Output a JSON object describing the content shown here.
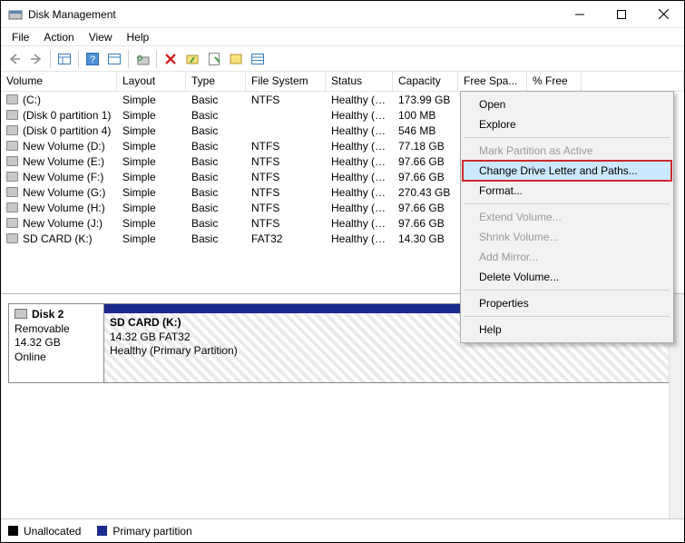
{
  "window": {
    "title": "Disk Management"
  },
  "menu": {
    "file": "File",
    "action": "Action",
    "view": "View",
    "help": "Help"
  },
  "columns": {
    "volume": "Volume",
    "layout": "Layout",
    "type": "Type",
    "fs": "File System",
    "status": "Status",
    "capacity": "Capacity",
    "free": "Free Spa...",
    "pfree": "% Free"
  },
  "volumes": [
    {
      "name": "(C:)",
      "layout": "Simple",
      "type": "Basic",
      "fs": "NTFS",
      "status": "Healthy (B...",
      "cap": "173.99 GB"
    },
    {
      "name": "(Disk 0 partition 1)",
      "layout": "Simple",
      "type": "Basic",
      "fs": "",
      "status": "Healthy (E...",
      "cap": "100 MB"
    },
    {
      "name": "(Disk 0 partition 4)",
      "layout": "Simple",
      "type": "Basic",
      "fs": "",
      "status": "Healthy (R...",
      "cap": "546 MB"
    },
    {
      "name": "New Volume (D:)",
      "layout": "Simple",
      "type": "Basic",
      "fs": "NTFS",
      "status": "Healthy (B...",
      "cap": "77.18 GB"
    },
    {
      "name": "New Volume (E:)",
      "layout": "Simple",
      "type": "Basic",
      "fs": "NTFS",
      "status": "Healthy (B...",
      "cap": "97.66 GB"
    },
    {
      "name": "New Volume (F:)",
      "layout": "Simple",
      "type": "Basic",
      "fs": "NTFS",
      "status": "Healthy (B...",
      "cap": "97.66 GB"
    },
    {
      "name": "New Volume (G:)",
      "layout": "Simple",
      "type": "Basic",
      "fs": "NTFS",
      "status": "Healthy (B...",
      "cap": "270.43 GB"
    },
    {
      "name": "New Volume (H:)",
      "layout": "Simple",
      "type": "Basic",
      "fs": "NTFS",
      "status": "Healthy (B...",
      "cap": "97.66 GB"
    },
    {
      "name": "New Volume (J:)",
      "layout": "Simple",
      "type": "Basic",
      "fs": "NTFS",
      "status": "Healthy (B...",
      "cap": "97.66 GB"
    },
    {
      "name": "SD CARD (K:)",
      "layout": "Simple",
      "type": "Basic",
      "fs": "FAT32",
      "status": "Healthy (P...",
      "cap": "14.30 GB"
    }
  ],
  "disk": {
    "label": "Disk 2",
    "type": "Removable",
    "size": "14.32 GB",
    "state": "Online",
    "partition": {
      "name": "SD CARD  (K:)",
      "detail": "14.32 GB FAT32",
      "status": "Healthy (Primary Partition)"
    }
  },
  "legend": {
    "unallocated": "Unallocated",
    "primary": "Primary partition"
  },
  "context": {
    "open": "Open",
    "explore": "Explore",
    "mark_active": "Mark Partition as Active",
    "change_letter": "Change Drive Letter and Paths...",
    "format": "Format...",
    "extend": "Extend Volume...",
    "shrink": "Shrink Volume...",
    "mirror": "Add Mirror...",
    "delete": "Delete Volume...",
    "properties": "Properties",
    "help": "Help"
  }
}
